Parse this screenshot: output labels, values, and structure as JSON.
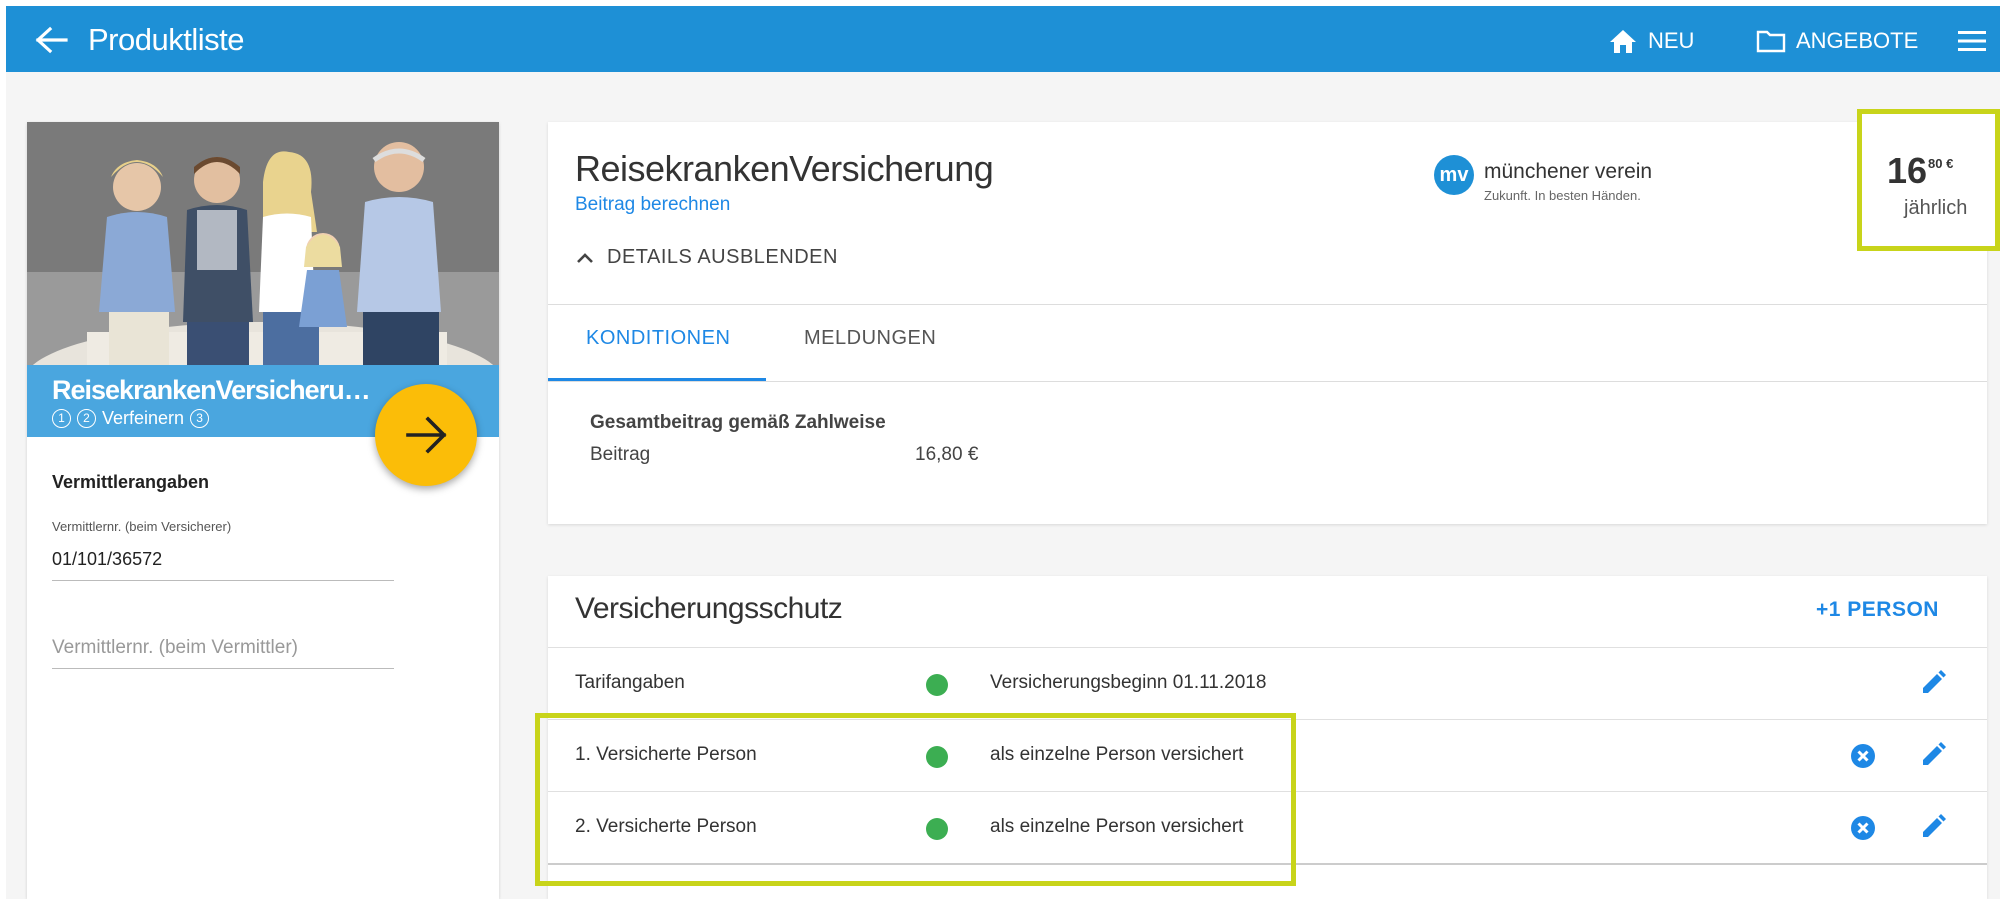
{
  "appbar": {
    "title": "Produktliste",
    "actions": {
      "neu": {
        "label": "NEU",
        "icon": "home-icon"
      },
      "angebote": {
        "label": "ANGEBOTE",
        "icon": "folder-icon"
      }
    },
    "menu_icon": "hamburger-menu-icon"
  },
  "colors": {
    "primary": "#1e90d6",
    "link": "#1e88e5",
    "fab": "#fbbd08",
    "highlight": "#c8d41a",
    "status_ok": "#3cae52"
  },
  "sidebar": {
    "product_name": "ReisekrankenVersicheru…",
    "steps": {
      "step1": "1",
      "step2": "2",
      "current": "Verfeinern",
      "step3": "3"
    },
    "section_title": "Vermittlerangaben",
    "field_versicherer": {
      "label": "Vermittlernr. (beim Versicherer)",
      "value": "01/101/36572"
    },
    "field_vermittler": {
      "placeholder": "Vermittlernr. (beim Vermittler)"
    }
  },
  "product": {
    "title": "ReisekrankenVersicherung",
    "calc_link": "Beitrag berechnen",
    "toggle_label": "DETAILS AUSBLENDEN",
    "insurer": {
      "logo_text": "mv",
      "name": "münchener verein",
      "slogan": "Zukunft. In besten Händen."
    },
    "tabs": {
      "active": "KONDITIONEN",
      "other": "MELDUNGEN"
    },
    "konditionen": {
      "heading": "Gesamtbeitrag gemäß Zahlweise",
      "row_label": "Beitrag",
      "row_value": "16,80 €"
    }
  },
  "price": {
    "integer": "16",
    "fraction": "80 €",
    "period": "jährlich"
  },
  "coverage": {
    "title": "Versicherungsschutz",
    "add_person": "+1  PERSON",
    "rows": [
      {
        "label": "Tarifangaben",
        "status": "ok",
        "description": "Versicherungsbeginn 01.11.2018",
        "deletable": false
      },
      {
        "label": "1. Versicherte Person",
        "status": "ok",
        "description": "als einzelne Person versichert",
        "deletable": true
      },
      {
        "label": "2. Versicherte Person",
        "status": "ok",
        "description": "als einzelne Person versichert",
        "deletable": true
      }
    ]
  }
}
